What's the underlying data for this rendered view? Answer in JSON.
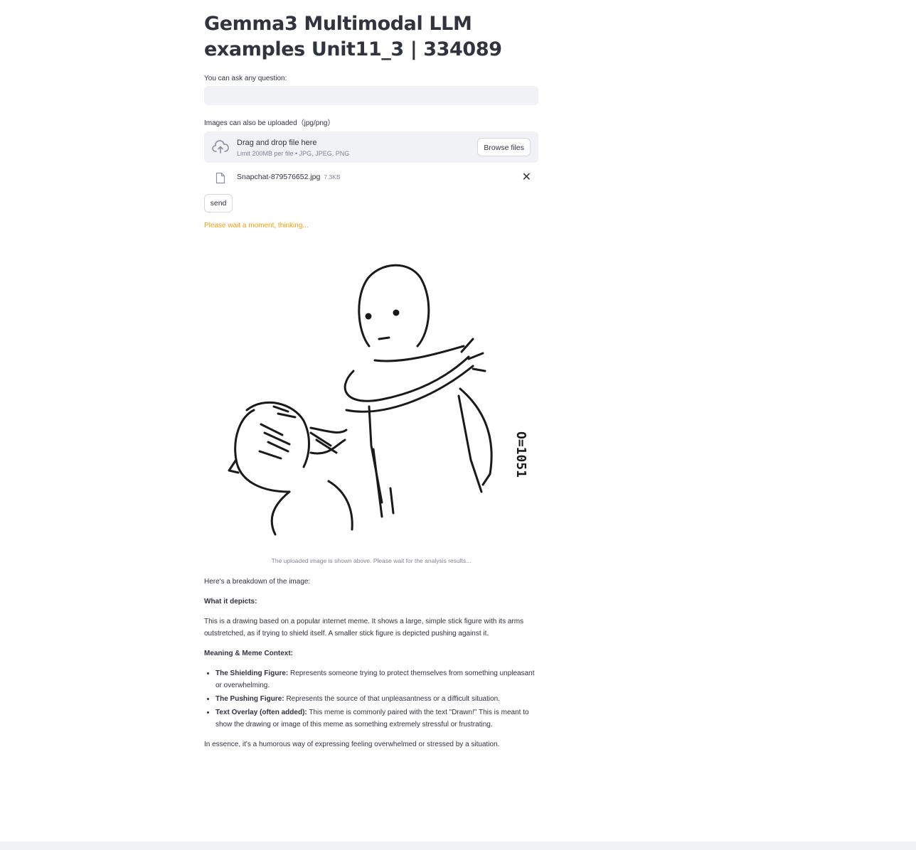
{
  "title": "Gemma3 Multimodal LLM examples Unit11_3 | 334089",
  "question": {
    "label": "You can ask any question:",
    "value": ""
  },
  "upload": {
    "label": "Images can also be uploaded（jpg/png）",
    "drop_title": "Drag and drop file here",
    "drop_sub": "Limit 200MB per file • JPG, JPEG, PNG",
    "browse_label": "Browse files",
    "file_name": "Snapchat-879576652.jpg",
    "file_size": "7.3KB"
  },
  "send_label": "send",
  "status_text": "Please wait a moment, thinking...",
  "image_caption": "The uploaded image is shown above. Please wait for the analysis results...",
  "drawing_text": "O=1051",
  "answer": {
    "intro": "Here's a breakdown of the image:",
    "depicts_heading": "What it depicts:",
    "depicts_text": "This is a drawing based on a popular internet meme. It shows a large, simple stick figure with its arms outstretched, as if trying to shield itself. A smaller stick figure is depicted pushing against it.",
    "meaning_heading": "Meaning & Meme Context:",
    "bullets": [
      {
        "label": "The Shielding Figure:",
        "text": " Represents someone trying to protect themselves from something unpleasant or overwhelming."
      },
      {
        "label": "The Pushing Figure:",
        "text": " Represents the source of that unpleasantness or a difficult situation."
      },
      {
        "label": "Text Overlay (often added):",
        "text": " This meme is commonly paired with the text \"Drawn!\" This is meant to show the drawing or image of this meme as something extremely stressful or frustrating."
      }
    ],
    "conclusion": "In essence, it's a humorous way of expressing feeling overwhelmed or stressed by a situation."
  },
  "colors": {
    "warning": "#f59e0b",
    "input_bg": "#f0f2f6",
    "text": "#31333f"
  }
}
